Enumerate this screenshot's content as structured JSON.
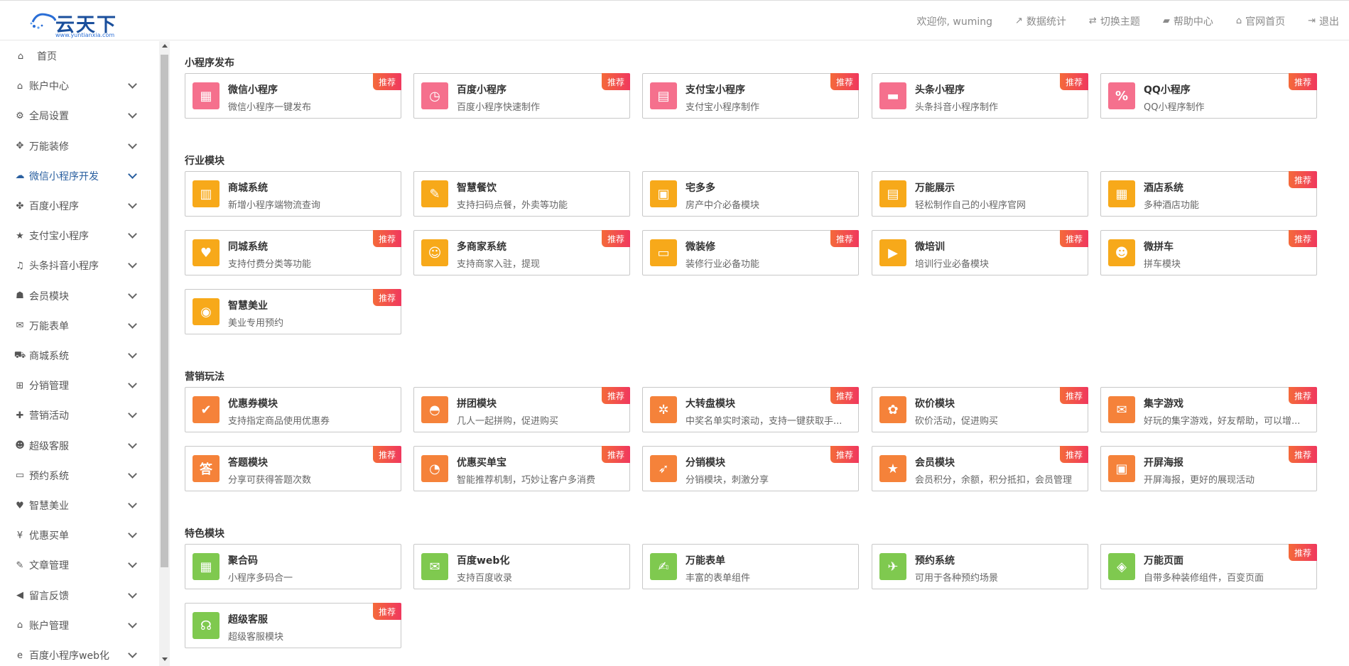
{
  "brand": {
    "logo_text": "云天下",
    "logo_url": "www.yuntianxia.com"
  },
  "topnav": [
    {
      "label": "欢迎你, wuming",
      "icon": ""
    },
    {
      "label": "数据统计",
      "icon": "chart-icon"
    },
    {
      "label": "切换主题",
      "icon": "switch-icon"
    },
    {
      "label": "帮助中心",
      "icon": "book-icon"
    },
    {
      "label": "官网首页",
      "icon": "home-icon"
    },
    {
      "label": "退出",
      "icon": "logout-icon"
    }
  ],
  "sidebar": [
    {
      "label": "首页",
      "icon": "home-icon"
    },
    {
      "label": "账户中心",
      "icon": "home-icon"
    },
    {
      "label": "全局设置",
      "icon": "gear-icon"
    },
    {
      "label": "万能装修",
      "icon": "move-icon"
    },
    {
      "label": "微信小程序开发",
      "icon": "wechat-icon"
    },
    {
      "label": "百度小程序",
      "icon": "paw-icon"
    },
    {
      "label": "支付宝小程序",
      "icon": "star-icon"
    },
    {
      "label": "头条抖音小程序",
      "icon": "music-icon"
    },
    {
      "label": "会员模块",
      "icon": "user-icon"
    },
    {
      "label": "万能表单",
      "icon": "envelope-icon"
    },
    {
      "label": "商城系统",
      "icon": "cart-icon"
    },
    {
      "label": "分销管理",
      "icon": "sitemap-icon"
    },
    {
      "label": "营销活动",
      "icon": "gift-icon"
    },
    {
      "label": "超级客服",
      "icon": "users-icon"
    },
    {
      "label": "预约系统",
      "icon": "calendar-icon"
    },
    {
      "label": "智慧美业",
      "icon": "heart-icon"
    },
    {
      "label": "优惠买单",
      "icon": "yen-icon"
    },
    {
      "label": "文章管理",
      "icon": "pencil-icon"
    },
    {
      "label": "留言反馈",
      "icon": "volume-icon"
    },
    {
      "label": "账户管理",
      "icon": "home-icon"
    },
    {
      "label": "百度小程序web化",
      "icon": "ie-icon"
    }
  ],
  "badge_label": "推荐",
  "sections": [
    {
      "title": "小程序发布",
      "cards": [
        {
          "title": "微信小程序",
          "desc": "微信小程序一键发布",
          "badge": true,
          "color": "pink",
          "glyph": "▦"
        },
        {
          "title": "百度小程序",
          "desc": "百度小程序快速制作",
          "badge": true,
          "color": "pink",
          "glyph": "◷"
        },
        {
          "title": "支付宝小程序",
          "desc": "支付宝小程序制作",
          "badge": true,
          "color": "pink",
          "glyph": "▤"
        },
        {
          "title": "头条小程序",
          "desc": "头条抖音小程序制作",
          "badge": true,
          "color": "pink",
          "glyph": "▬"
        },
        {
          "title": "QQ小程序",
          "desc": "QQ小程序制作",
          "badge": true,
          "color": "pink",
          "glyph": "%"
        }
      ]
    },
    {
      "title": "行业模块",
      "cards": [
        {
          "title": "商城系统",
          "desc": "新增小程序端物流查询",
          "badge": false,
          "color": "yellow",
          "glyph": "▥"
        },
        {
          "title": "智慧餐饮",
          "desc": "支持扫码点餐，外卖等功能",
          "badge": false,
          "color": "yellow",
          "glyph": "✎"
        },
        {
          "title": "宅多多",
          "desc": "房产中介必备模块",
          "badge": false,
          "color": "yellow",
          "glyph": "▣"
        },
        {
          "title": "万能展示",
          "desc": "轻松制作自己的小程序官网",
          "badge": false,
          "color": "yellow",
          "glyph": "▤"
        },
        {
          "title": "酒店系统",
          "desc": "多种酒店功能",
          "badge": true,
          "color": "yellow",
          "glyph": "▦"
        },
        {
          "title": "同城系统",
          "desc": "支持付费分类等功能",
          "badge": true,
          "color": "yellow",
          "glyph": "♥"
        },
        {
          "title": "多商家系统",
          "desc": "支持商家入驻，提现",
          "badge": true,
          "color": "yellow",
          "glyph": "☺"
        },
        {
          "title": "微装修",
          "desc": "装修行业必备功能",
          "badge": true,
          "color": "yellow",
          "glyph": "▭"
        },
        {
          "title": "微培训",
          "desc": "培训行业必备模块",
          "badge": true,
          "color": "yellow",
          "glyph": "▶"
        },
        {
          "title": "微拼车",
          "desc": "拼车模块",
          "badge": true,
          "color": "yellow",
          "glyph": "☻"
        },
        {
          "title": "智慧美业",
          "desc": "美业专用预约",
          "badge": true,
          "color": "yellow",
          "glyph": "◉"
        }
      ]
    },
    {
      "title": "营销玩法",
      "cards": [
        {
          "title": "优惠券模块",
          "desc": "支持指定商品使用优惠券",
          "badge": false,
          "color": "orange",
          "glyph": "✔"
        },
        {
          "title": "拼团模块",
          "desc": "几人一起拼购，促进购买",
          "badge": true,
          "color": "orange",
          "glyph": "◓"
        },
        {
          "title": "大转盘模块",
          "desc": "中奖名单实时滚动，支持一键获取手...",
          "badge": true,
          "color": "orange",
          "glyph": "✲"
        },
        {
          "title": "砍价模块",
          "desc": "砍价活动，促进购买",
          "badge": true,
          "color": "orange",
          "glyph": "✿"
        },
        {
          "title": "集字游戏",
          "desc": "好玩的集字游戏，好友帮助，可以增...",
          "badge": true,
          "color": "orange",
          "glyph": "✉"
        },
        {
          "title": "答题模块",
          "desc": "分享可获得答题次数",
          "badge": true,
          "color": "orange",
          "glyph": "答"
        },
        {
          "title": "优惠买单宝",
          "desc": "智能推荐机制，巧妙让客户多消费",
          "badge": true,
          "color": "orange",
          "glyph": "◔"
        },
        {
          "title": "分销模块",
          "desc": "分销模块，刺激分享",
          "badge": true,
          "color": "orange",
          "glyph": "➶"
        },
        {
          "title": "会员模块",
          "desc": "会员积分，余额，积分抵扣，会员管理",
          "badge": true,
          "color": "orange",
          "glyph": "★"
        },
        {
          "title": "开屏海报",
          "desc": "开屏海报，更好的展现活动",
          "badge": true,
          "color": "orange",
          "glyph": "▣"
        }
      ]
    },
    {
      "title": "特色模块",
      "cards": [
        {
          "title": "聚合码",
          "desc": "小程序多码合一",
          "badge": false,
          "color": "green",
          "glyph": "▦"
        },
        {
          "title": "百度web化",
          "desc": "支持百度收录",
          "badge": false,
          "color": "green",
          "glyph": "✉"
        },
        {
          "title": "万能表单",
          "desc": "丰富的表单组件",
          "badge": false,
          "color": "green",
          "glyph": "✍"
        },
        {
          "title": "预约系统",
          "desc": "可用于各种预约场景",
          "badge": false,
          "color": "green",
          "glyph": "✈"
        },
        {
          "title": "万能页面",
          "desc": "自带多种装修组件，百变页面",
          "badge": true,
          "color": "green",
          "glyph": "◈"
        },
        {
          "title": "超级客服",
          "desc": "超级客服模块",
          "badge": true,
          "color": "green",
          "glyph": "☊"
        }
      ]
    }
  ]
}
